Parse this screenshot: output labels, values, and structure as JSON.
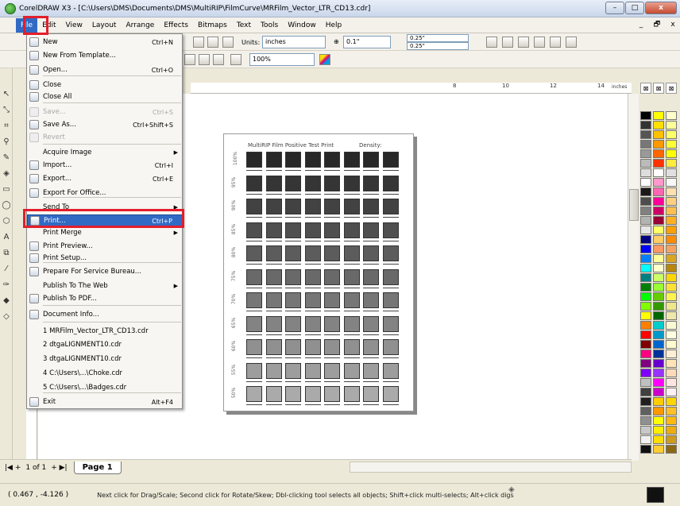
{
  "window": {
    "title": "CorelDRAW X3 - [C:\\Users\\DMS\\Documents\\DMS\\MultiRIP\\FilmCurve\\MRFilm_Vector_LTR_CD13.cdr]"
  },
  "window_controls": {
    "minimize": "–",
    "maximize": "□",
    "close": "x"
  },
  "mdi_controls": {
    "minimize": "_",
    "restore": "🗗",
    "close": "x"
  },
  "menubar": [
    "File",
    "Edit",
    "View",
    "Layout",
    "Arrange",
    "Effects",
    "Bitmaps",
    "Text",
    "Tools",
    "Window",
    "Help"
  ],
  "toolbar": {
    "units_label": "Units:",
    "units_value": "inches",
    "nudge_value": "0.1\"",
    "dup_x": "0.25\"",
    "dup_y": "0.25\"",
    "zoom_value": "100%"
  },
  "ruler": {
    "unit_label": "inches",
    "ticks": [
      "8",
      "10",
      "12",
      "14"
    ]
  },
  "file_menu": [
    {
      "label": "New",
      "shortcut": "Ctrl+N",
      "type": "item",
      "disabled": false
    },
    {
      "label": "New From Template...",
      "shortcut": "",
      "type": "item",
      "disabled": false
    },
    {
      "label": "Open...",
      "shortcut": "Ctrl+O",
      "type": "item",
      "disabled": false
    },
    {
      "label": "Close",
      "shortcut": "",
      "type": "item",
      "disabled": false
    },
    {
      "label": "Close All",
      "shortcut": "",
      "type": "item",
      "disabled": false
    },
    {
      "label": "Save...",
      "shortcut": "Ctrl+S",
      "type": "item",
      "disabled": true
    },
    {
      "label": "Save As...",
      "shortcut": "Ctrl+Shift+S",
      "type": "item",
      "disabled": false
    },
    {
      "label": "Revert",
      "shortcut": "",
      "type": "item",
      "disabled": true
    },
    {
      "label": "Acquire Image",
      "shortcut": "",
      "type": "submenu",
      "disabled": false
    },
    {
      "label": "Import...",
      "shortcut": "Ctrl+I",
      "type": "item",
      "disabled": false
    },
    {
      "label": "Export...",
      "shortcut": "Ctrl+E",
      "type": "item",
      "disabled": false
    },
    {
      "label": "Export For Office...",
      "shortcut": "",
      "type": "item",
      "disabled": false
    },
    {
      "label": "Send To",
      "shortcut": "",
      "type": "submenu",
      "disabled": false
    },
    {
      "label": "Print...",
      "shortcut": "Ctrl+P",
      "type": "highlight",
      "disabled": false
    },
    {
      "label": "Print Merge",
      "shortcut": "",
      "type": "submenu",
      "disabled": false
    },
    {
      "label": "Print Preview...",
      "shortcut": "",
      "type": "item",
      "disabled": false
    },
    {
      "label": "Print Setup...",
      "shortcut": "",
      "type": "item",
      "disabled": false
    },
    {
      "label": "Prepare For Service Bureau...",
      "shortcut": "",
      "type": "item",
      "disabled": false
    },
    {
      "label": "Publish To The Web",
      "shortcut": "",
      "type": "submenu",
      "disabled": false
    },
    {
      "label": "Publish To PDF...",
      "shortcut": "",
      "type": "item",
      "disabled": false
    },
    {
      "label": "Document Info...",
      "shortcut": "",
      "type": "item",
      "disabled": false
    },
    {
      "label": "1 MRFilm_Vector_LTR_CD13.cdr",
      "shortcut": "",
      "type": "recent",
      "disabled": false
    },
    {
      "label": "2 dtgaLIGNMENT10.cdr",
      "shortcut": "",
      "type": "recent",
      "disabled": false
    },
    {
      "label": "3 dtgaLIGNMENT10.cdr",
      "shortcut": "",
      "type": "recent",
      "disabled": false
    },
    {
      "label": "4 C:\\Users\\...\\Choke.cdr",
      "shortcut": "",
      "type": "recent",
      "disabled": false
    },
    {
      "label": "5 C:\\Users\\...\\Badges.cdr",
      "shortcut": "",
      "type": "recent",
      "disabled": false
    },
    {
      "label": "Exit",
      "shortcut": "Alt+F4",
      "type": "item",
      "disabled": false
    }
  ],
  "test_page": {
    "title": "MultiRIP Film Positive Test Print",
    "density_label": "Density:",
    "row_labels": [
      "100%",
      "95%",
      "90%",
      "85%",
      "80%",
      "75%",
      "70%",
      "65%",
      "60%",
      "55%",
      "50%"
    ]
  },
  "page_nav": {
    "count_text": "1 of 1",
    "tab_label": "Page 1"
  },
  "status": {
    "coords": "( 0.467 , -4.126 )",
    "message": "Next click for Drag/Scale; Second click for Rotate/Skew; Dbl-clicking tool selects all objects; Shift+click multi-selects; Alt+click digs"
  },
  "colors": {
    "highlight": "#316ac5",
    "annotation": "#e41e2b"
  }
}
